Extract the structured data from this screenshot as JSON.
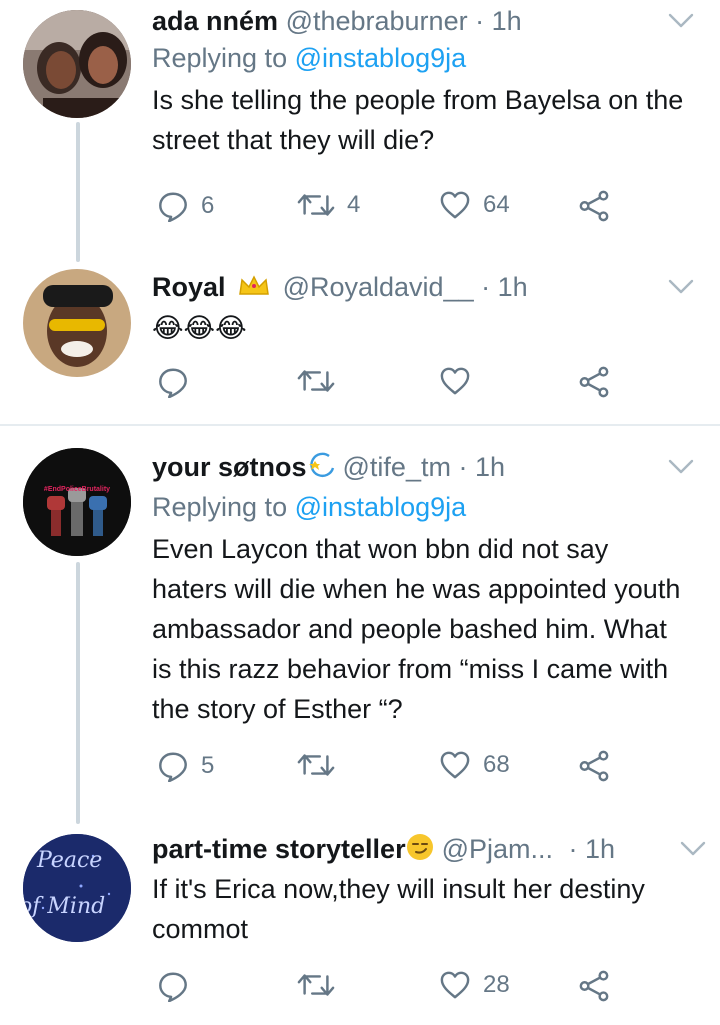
{
  "tweets": [
    {
      "name": "ada nném",
      "name_emoji": "",
      "handle": "@thebraburner",
      "time": "· 1h",
      "reply_prefix": "Replying to",
      "reply_to": "@instablog9ja",
      "text": "Is she telling the people from Bayelsa on the street that they will die?",
      "replies": "6",
      "retweets": "4",
      "likes": "64"
    },
    {
      "name": "Royal",
      "name_emoji": "crown-emoji",
      "handle": "@Royaldavid__",
      "time": "· 1h",
      "text": "😂😂😂",
      "replies": "",
      "retweets": "",
      "likes": ""
    },
    {
      "name": "your søtnos",
      "name_emoji": "dizzy-emoji",
      "handle": "@tife_tm",
      "time": "· 1h",
      "reply_prefix": "Replying to",
      "reply_to": "@instablog9ja",
      "avatar_text": "#EndPoliceBrutality",
      "text": "Even Laycon that won bbn did not say haters will die when he was appointed youth ambassador and people bashed him. What is this razz behavior from “miss I came with the story of Esther “?",
      "replies": "5",
      "retweets": "",
      "likes": "68"
    },
    {
      "name": "part-time storyteller",
      "name_emoji": "smirk-emoji",
      "handle": "@Pjam...",
      "time": "· 1h",
      "avatar_text_1": "Peace",
      "avatar_text_2": "of Mind",
      "text": "If it's Erica now,they will insult her destiny commot",
      "replies": "",
      "retweets": "",
      "likes": "28"
    }
  ],
  "colors": {
    "name": "#14171a",
    "meta": "#657786",
    "mention": "#1da1f2",
    "thread_line": "#ccd6dd",
    "divider": "#e6ecf0"
  }
}
